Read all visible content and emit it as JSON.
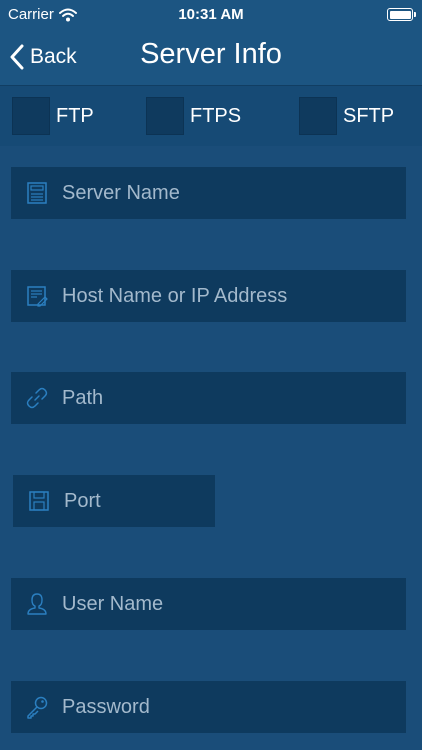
{
  "status_bar": {
    "carrier": "Carrier",
    "time": "10:31 AM",
    "battery_level": 1.0
  },
  "nav": {
    "back_label": "Back",
    "title": "Server Info"
  },
  "protocols": [
    {
      "label": "FTP",
      "checked": false
    },
    {
      "label": "FTPS",
      "checked": false
    },
    {
      "label": "SFTP",
      "checked": false
    }
  ],
  "fields": {
    "server_name": {
      "placeholder": "Server Name",
      "icon": "server-icon"
    },
    "host": {
      "placeholder": "Host Name or IP Address",
      "icon": "host-document-icon"
    },
    "path": {
      "placeholder": "Path",
      "icon": "link-icon"
    },
    "port": {
      "placeholder": "Port",
      "icon": "floppy-disk-icon"
    },
    "user_name": {
      "placeholder": "User Name",
      "icon": "user-icon"
    },
    "password": {
      "placeholder": "Password",
      "icon": "key-icon"
    }
  },
  "colors": {
    "background": "#1a4d79",
    "bar": "#1c5582",
    "field": "#0e3a5e",
    "icon_accent": "#2b7fc0",
    "placeholder": "#a3b9cc"
  }
}
